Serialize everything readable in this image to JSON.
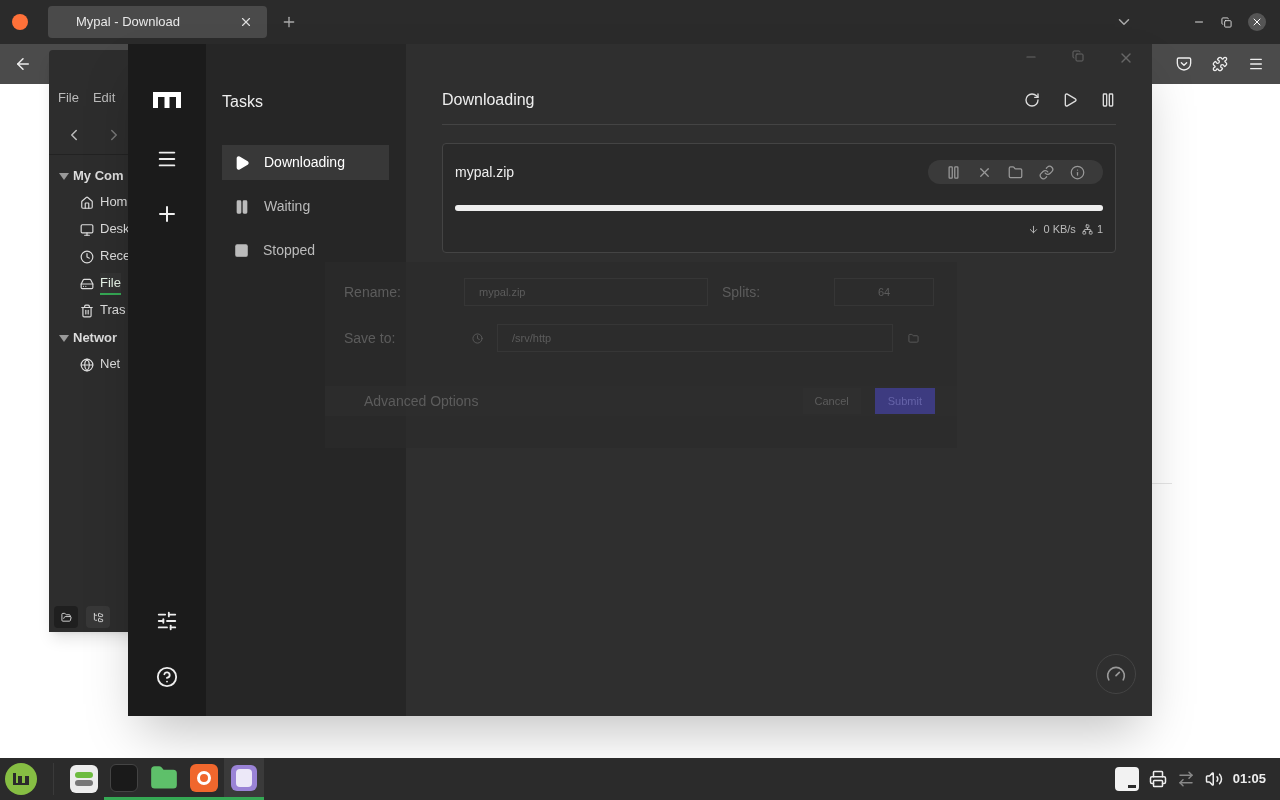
{
  "browser": {
    "tab_title": "Mypal - Download"
  },
  "file_manager": {
    "menu": [
      "File",
      "Edit"
    ],
    "sections": [
      {
        "title": "My Com",
        "items": [
          {
            "label": "Hom",
            "kind": "home",
            "selected": false
          },
          {
            "label": "Desk",
            "kind": "desktop",
            "selected": false
          },
          {
            "label": "Rece",
            "kind": "recent",
            "selected": false
          },
          {
            "label": "File",
            "kind": "drive",
            "selected": true
          },
          {
            "label": "Tras",
            "kind": "trash",
            "selected": false
          }
        ]
      },
      {
        "title": "Networ",
        "items": [
          {
            "label": "Net",
            "kind": "network",
            "selected": false
          }
        ]
      }
    ]
  },
  "app": {
    "tasks_title": "Tasks",
    "filters": [
      {
        "label": "Downloading",
        "kind": "active",
        "selected": true
      },
      {
        "label": "Waiting",
        "kind": "waiting",
        "selected": false
      },
      {
        "label": "Stopped",
        "kind": "stopped",
        "selected": false
      }
    ],
    "list_title": "Downloading",
    "tasks": [
      {
        "name": "mypal.zip",
        "level": 1,
        "speed": "0 KB/s",
        "connections": "1"
      }
    ],
    "dialog": {
      "rename_label": "Rename:",
      "rename_value": "mypal.zip",
      "splits_label": "Splits:",
      "splits_value": "64",
      "save_to_label": "Save to:",
      "save_to_value": "/srv/http",
      "advanced": "Advanced Options",
      "cancel": "Cancel",
      "submit": "Submit"
    }
  },
  "taskbar": {
    "clock": "01:05"
  }
}
